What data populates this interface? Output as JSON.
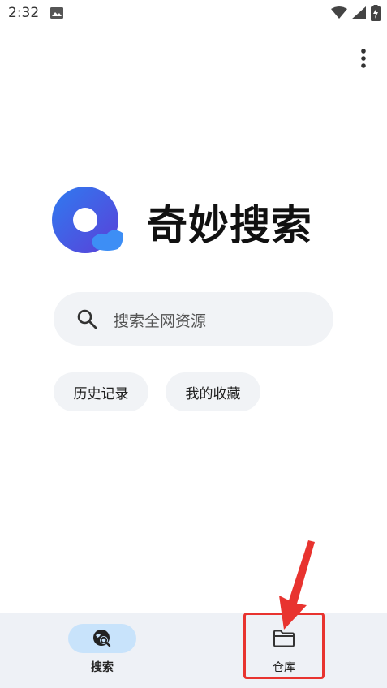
{
  "status_bar": {
    "time": "2:32",
    "icons": [
      "image-icon",
      "wifi-icon",
      "signal-icon",
      "battery-charging-icon"
    ]
  },
  "header": {
    "more_icon": "more-vert-icon"
  },
  "brand": {
    "title": "奇妙搜索",
    "logo_icon": "search-logo-icon",
    "logo_colors": [
      "#2f7bf0",
      "#5b3fd8"
    ]
  },
  "search": {
    "placeholder": "搜索全网资源",
    "icon": "search-icon"
  },
  "quick_actions": {
    "history": "历史记录",
    "favorites": "我的收藏"
  },
  "bottom_nav": {
    "items": [
      {
        "label": "搜索",
        "icon": "search-globe-icon",
        "active": true
      },
      {
        "label": "仓库",
        "icon": "folder-icon",
        "active": false
      }
    ]
  },
  "colors": {
    "accent_pill": "#c8e3fb",
    "surface": "#f1f3f6",
    "nav_background": "#eef1f6",
    "annotation_red": "#e8332f"
  }
}
